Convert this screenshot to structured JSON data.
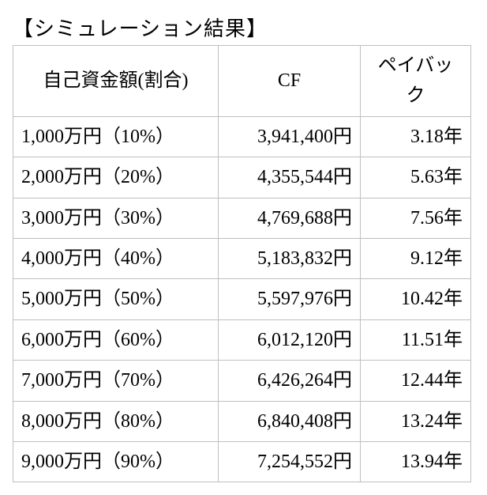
{
  "title": "【シミュレーション結果】",
  "headers": {
    "c1": "自己資金額(割合)",
    "c2": "CF",
    "c3": "ペイバック"
  },
  "rows": [
    {
      "c1": "1,000万円（10%）",
      "c2": "3,941,400円",
      "c3": "3.18年"
    },
    {
      "c1": "2,000万円（20%）",
      "c2": "4,355,544円",
      "c3": "5.63年"
    },
    {
      "c1": "3,000万円（30%）",
      "c2": "4,769,688円",
      "c3": "7.56年"
    },
    {
      "c1": "4,000万円（40%）",
      "c2": "5,183,832円",
      "c3": "9.12年"
    },
    {
      "c1": "5,000万円（50%）",
      "c2": "5,597,976円",
      "c3": "10.42年"
    },
    {
      "c1": "6,000万円（60%）",
      "c2": "6,012,120円",
      "c3": "11.51年"
    },
    {
      "c1": "7,000万円（70%）",
      "c2": "6,426,264円",
      "c3": "12.44年"
    },
    {
      "c1": "8,000万円（80%）",
      "c2": "6,840,408円",
      "c3": "13.24年"
    },
    {
      "c1": "9,000万円（90%）",
      "c2": "7,254,552円",
      "c3": "13.94年"
    }
  ],
  "chart_data": {
    "type": "table",
    "title": "シミュレーション結果",
    "columns": [
      "自己資金額(割合)",
      "CF",
      "ペイバック"
    ],
    "series": [
      {
        "name": "自己資金額(万円)",
        "values": [
          1000,
          2000,
          3000,
          4000,
          5000,
          6000,
          7000,
          8000,
          9000
        ]
      },
      {
        "name": "割合(%)",
        "values": [
          10,
          20,
          30,
          40,
          50,
          60,
          70,
          80,
          90
        ]
      },
      {
        "name": "CF(円)",
        "values": [
          3941400,
          4355544,
          4769688,
          5183832,
          5597976,
          6012120,
          6426264,
          6840408,
          7254552
        ]
      },
      {
        "name": "ペイバック(年)",
        "values": [
          3.18,
          5.63,
          7.56,
          9.12,
          10.42,
          11.51,
          12.44,
          13.24,
          13.94
        ]
      }
    ]
  }
}
